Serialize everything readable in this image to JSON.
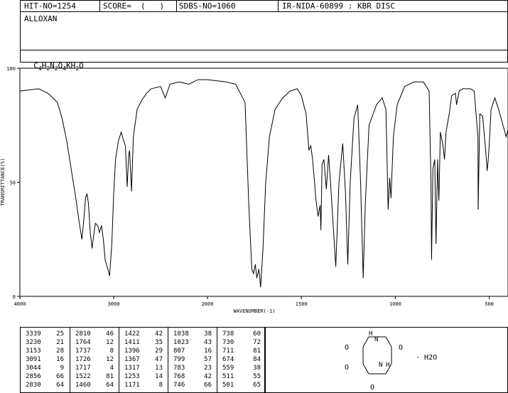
{
  "header": {
    "hit_no": "HIT-NO=1254",
    "score": "SCORE=  (   )",
    "sdbs_no": "SDBS-NO=1060",
    "ir_no": "IR-NIDA-60899 : KBR DISC",
    "compound": "ALLOXAN",
    "formula_parts": [
      "C",
      "4",
      "H",
      "2",
      "N",
      "2",
      "O",
      "4",
      "KH",
      "2",
      "O"
    ]
  },
  "chart_data": {
    "type": "line",
    "xlabel": "WAVENUMBER(-1)",
    "ylabel": "TRANSMITTANCE(%)",
    "xlim": [
      4000,
      400
    ],
    "ylim": [
      0,
      100
    ],
    "x_ticks": [
      4000,
      3000,
      2000,
      1500,
      1000,
      500
    ],
    "y_ticks": [
      0,
      50,
      100
    ],
    "grid": false,
    "series": [
      {
        "points": [
          [
            4000,
            90
          ],
          [
            3900,
            90.5
          ],
          [
            3800,
            91
          ],
          [
            3700,
            89
          ],
          [
            3600,
            85
          ],
          [
            3550,
            78
          ],
          [
            3500,
            68
          ],
          [
            3450,
            55
          ],
          [
            3400,
            42
          ],
          [
            3370,
            33
          ],
          [
            3339,
            25
          ],
          [
            3320,
            33
          ],
          [
            3300,
            43
          ],
          [
            3285,
            45
          ],
          [
            3270,
            41
          ],
          [
            3250,
            28
          ],
          [
            3230,
            21
          ],
          [
            3210,
            28
          ],
          [
            3195,
            32
          ],
          [
            3170,
            31
          ],
          [
            3153,
            28
          ],
          [
            3130,
            31
          ],
          [
            3110,
            25
          ],
          [
            3091,
            16
          ],
          [
            3070,
            13
          ],
          [
            3044,
            9
          ],
          [
            3020,
            23
          ],
          [
            3000,
            45
          ],
          [
            2980,
            60
          ],
          [
            2950,
            68
          ],
          [
            2920,
            72
          ],
          [
            2900,
            69
          ],
          [
            2875,
            66
          ],
          [
            2856,
            48
          ],
          [
            2840,
            62
          ],
          [
            2830,
            64
          ],
          [
            2810,
            46
          ],
          [
            2790,
            70
          ],
          [
            2750,
            82
          ],
          [
            2700,
            86
          ],
          [
            2650,
            89
          ],
          [
            2600,
            91
          ],
          [
            2500,
            92
          ],
          [
            2450,
            87
          ],
          [
            2400,
            93
          ],
          [
            2300,
            94
          ],
          [
            2200,
            93
          ],
          [
            2100,
            95
          ],
          [
            2000,
            95
          ],
          [
            1900,
            94
          ],
          [
            1850,
            93
          ],
          [
            1800,
            85
          ],
          [
            1780,
            40
          ],
          [
            1764,
            12
          ],
          [
            1755,
            10
          ],
          [
            1745,
            14
          ],
          [
            1737,
            8
          ],
          [
            1726,
            12
          ],
          [
            1717,
            4
          ],
          [
            1705,
            20
          ],
          [
            1690,
            50
          ],
          [
            1670,
            70
          ],
          [
            1640,
            82
          ],
          [
            1600,
            87
          ],
          [
            1560,
            90
          ],
          [
            1522,
            91
          ],
          [
            1500,
            88
          ],
          [
            1475,
            80
          ],
          [
            1460,
            64
          ],
          [
            1450,
            66
          ],
          [
            1440,
            60
          ],
          [
            1430,
            50
          ],
          [
            1422,
            42
          ],
          [
            1411,
            35
          ],
          [
            1400,
            40
          ],
          [
            1396,
            29
          ],
          [
            1390,
            58
          ],
          [
            1380,
            60
          ],
          [
            1367,
            47
          ],
          [
            1355,
            62
          ],
          [
            1345,
            50
          ],
          [
            1317,
            13
          ],
          [
            1300,
            50
          ],
          [
            1280,
            67
          ],
          [
            1265,
            45
          ],
          [
            1253,
            14
          ],
          [
            1240,
            50
          ],
          [
            1220,
            78
          ],
          [
            1200,
            84
          ],
          [
            1185,
            50
          ],
          [
            1171,
            8
          ],
          [
            1160,
            40
          ],
          [
            1140,
            75
          ],
          [
            1100,
            84
          ],
          [
            1070,
            87
          ],
          [
            1050,
            82
          ],
          [
            1038,
            38
          ],
          [
            1030,
            52
          ],
          [
            1023,
            43
          ],
          [
            1010,
            70
          ],
          [
            990,
            84
          ],
          [
            950,
            92
          ],
          [
            900,
            94
          ],
          [
            850,
            94
          ],
          [
            820,
            90
          ],
          [
            810,
            50
          ],
          [
            807,
            16
          ],
          [
            800,
            56
          ],
          [
            790,
            60
          ],
          [
            783,
            23
          ],
          [
            775,
            60
          ],
          [
            768,
            42
          ],
          [
            760,
            72
          ],
          [
            746,
            66
          ],
          [
            738,
            60
          ],
          [
            730,
            72
          ],
          [
            711,
            81
          ],
          [
            700,
            88
          ],
          [
            680,
            89
          ],
          [
            674,
            84
          ],
          [
            660,
            90
          ],
          [
            640,
            91
          ],
          [
            600,
            91
          ],
          [
            580,
            90
          ],
          [
            560,
            70
          ],
          [
            559,
            38
          ],
          [
            550,
            80
          ],
          [
            535,
            79
          ],
          [
            520,
            65
          ],
          [
            511,
            55
          ],
          [
            505,
            60
          ],
          [
            501,
            65
          ],
          [
            490,
            82
          ],
          [
            470,
            87
          ],
          [
            450,
            82
          ],
          [
            430,
            76
          ],
          [
            410,
            70
          ],
          [
            400,
            73
          ]
        ]
      }
    ]
  },
  "peaks": {
    "columns": [
      [
        [
          "3339",
          "25"
        ],
        [
          "3230",
          "21"
        ],
        [
          "3153",
          "28"
        ],
        [
          "3091",
          "16"
        ],
        [
          "3044",
          "9"
        ],
        [
          "2856",
          "66"
        ],
        [
          "2830",
          "64"
        ]
      ],
      [
        [
          "2810",
          "46"
        ],
        [
          "1764",
          "12"
        ],
        [
          "1737",
          "8"
        ],
        [
          "1726",
          "12"
        ],
        [
          "1717",
          "4"
        ],
        [
          "1522",
          "81"
        ],
        [
          "1460",
          "64"
        ]
      ],
      [
        [
          "1422",
          "42"
        ],
        [
          "1411",
          "35"
        ],
        [
          "1396",
          "29"
        ],
        [
          "1367",
          "47"
        ],
        [
          "1317",
          "13"
        ],
        [
          "1253",
          "14"
        ],
        [
          "1171",
          "8"
        ]
      ],
      [
        [
          "1038",
          "38"
        ],
        [
          "1023",
          "43"
        ],
        [
          "807",
          "16"
        ],
        [
          "799",
          "57"
        ],
        [
          "783",
          "23"
        ],
        [
          "768",
          "42"
        ],
        [
          "746",
          "66"
        ]
      ],
      [
        [
          "738",
          "60"
        ],
        [
          "730",
          "72"
        ],
        [
          "711",
          "81"
        ],
        [
          "674",
          "84"
        ],
        [
          "559",
          "38"
        ],
        [
          "511",
          "55"
        ],
        [
          "501",
          "65"
        ]
      ]
    ]
  },
  "structure": {
    "atoms": [
      "O",
      "O",
      "O",
      "O",
      "H",
      "H",
      "N",
      "N"
    ],
    "hydrate": "H2O"
  }
}
